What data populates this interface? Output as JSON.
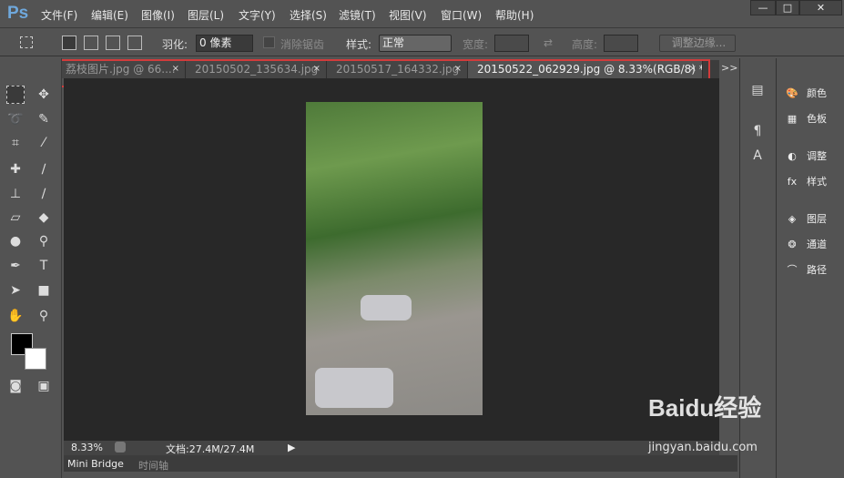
{
  "app": {
    "logo": "Ps"
  },
  "menu": [
    "文件(F)",
    "编辑(E)",
    "图像(I)",
    "图层(L)",
    "文字(Y)",
    "选择(S)",
    "滤镜(T)",
    "视图(V)",
    "窗口(W)",
    "帮助(H)"
  ],
  "window_controls": {
    "minimize": "—",
    "maximize": "□",
    "close": "✕"
  },
  "options": {
    "feather_label": "羽化:",
    "feather_value": "0 像素",
    "antialias_label": "消除锯齿",
    "style_label": "样式:",
    "style_value": "正常",
    "width_label": "宽度:",
    "height_label": "高度:",
    "refine_edge": "调整边缘..."
  },
  "tabs": [
    {
      "label": "荔枝图片.jpg @ 66....",
      "active": false
    },
    {
      "label": "20150502_135634.jpg",
      "active": false
    },
    {
      "label": "20150517_164332.jpg",
      "active": false
    },
    {
      "label": "20150522_062929.jpg @ 8.33%(RGB/8) *",
      "active": true
    }
  ],
  "tab_close": "×",
  "tabs_overflow": ">>",
  "status": {
    "zoom": "8.33%",
    "doc": "文档:27.4M/27.4M"
  },
  "bottom_tabs": [
    "Mini Bridge",
    "时间轴"
  ],
  "right_panel": [
    "颜色",
    "色板",
    "调整",
    "样式",
    "图层",
    "通道",
    "路径"
  ],
  "watermark": {
    "brand": "Baidu经验",
    "url": "jingyan.baidu.com"
  },
  "highlight_color": "#d23b3b"
}
